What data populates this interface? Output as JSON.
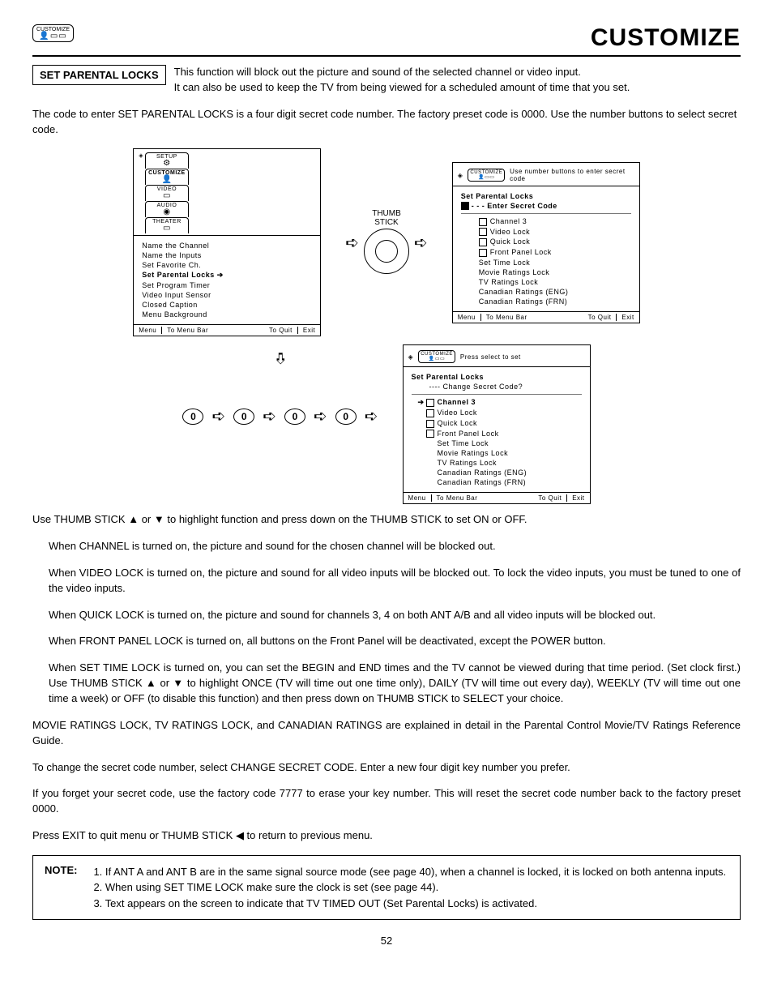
{
  "header": {
    "badge_label": "CUSTOMIZE",
    "page_title": "CUSTOMIZE"
  },
  "section": {
    "label": "SET PARENTAL LOCKS",
    "intro1": "This function will block out the picture and sound of the selected channel or video input.",
    "intro2": "It can also be used to keep the TV from being viewed for a scheduled amount of time that you set."
  },
  "body": {
    "p1": "The code to enter SET PARENTAL LOCKS is a four digit secret code number.  The factory preset code is 0000. Use the number buttons to select secret code.",
    "thumb_label1": "THUMB",
    "thumb_label2": "STICK",
    "p2_a": "Use THUMB STICK ",
    "p2_b": " or ",
    "p2_c": " to highlight function and press down on the THUMB STICK to set ON or OFF.",
    "p3": "When CHANNEL is turned on, the picture and sound for the chosen channel will be blocked out.",
    "p4": "When VIDEO LOCK is turned on, the picture and sound for all video inputs will be blocked out. To lock the video inputs, you must be tuned to one of the video inputs.",
    "p5": "When QUICK LOCK is turned on, the picture and sound for channels 3, 4 on both ANT A/B and all video inputs will be blocked out.",
    "p6": "When FRONT PANEL LOCK is turned on, all buttons on the Front Panel will be deactivated, except the POWER button.",
    "p7_a": "When SET TIME LOCK is turned on, you can set the BEGIN and END times and the TV cannot be viewed during that time period. (Set clock first.) Use THUMB STICK ",
    "p7_b": " or ",
    "p7_c": " to highlight ONCE (TV will time out one time only), DAILY (TV will time out every day), WEEKLY (TV will time out one time a week) or OFF (to disable this function) and then press down on THUMB STICK to SELECT your choice.",
    "p8": "MOVIE RATINGS LOCK, TV RATINGS LOCK, and CANADIAN RATINGS are explained in detail in the Parental Control Movie/TV Ratings Reference Guide.",
    "p9": "To change the secret code number, select CHANGE SECRET CODE.  Enter a new four digit key number you prefer.",
    "p10": "If you forget your secret code, use the factory code 7777 to erase your key number. This will reset the secret code number back to the factory preset 0000.",
    "p11_a": "Press EXIT to quit menu or THUMB STICK ",
    "p11_b": " to return to previous menu."
  },
  "osd1": {
    "tabs": [
      "SETUP",
      "CUSTOMIZE",
      "VIDEO",
      "AUDIO",
      "THEATER"
    ],
    "items": [
      "Name the Channel",
      "Name the Inputs",
      "Set Favorite Ch.",
      "Set Parental Locks",
      "Set Program Timer",
      "Video Input Sensor",
      "Closed Caption",
      "Menu Background"
    ],
    "selected_index": 3,
    "footer": {
      "l": "Menu",
      "c": "To Menu Bar",
      "r1": "To Quit",
      "r2": "Exit"
    }
  },
  "osd2": {
    "hint": "Use number buttons to enter secret code",
    "title": "Set Parental Locks",
    "subtitle": "- - -  Enter Secret Code",
    "items": [
      "Channel 3",
      "Video Lock",
      "Quick Lock",
      "Front Panel Lock",
      "Set Time Lock",
      "Movie Ratings Lock",
      "TV Ratings Lock",
      "Canadian Ratings (ENG)",
      "Canadian Ratings (FRN)"
    ],
    "check_count": 4,
    "footer": {
      "l": "Menu",
      "c": "To Menu Bar",
      "r1": "To Quit",
      "r2": "Exit"
    }
  },
  "osd3": {
    "hint": "Press select to set",
    "title": "Set Parental Locks",
    "subtitle": "----  Change Secret Code?",
    "items": [
      "Channel 3",
      "Video Lock",
      "Quick Lock",
      "Front Panel Lock",
      "Set Time Lock",
      "Movie Ratings Lock",
      "TV Ratings Lock",
      "Canadian Ratings (ENG)",
      "Canadian Ratings (FRN)"
    ],
    "check_count": 4,
    "selected_index": 0,
    "footer": {
      "l": "Menu",
      "c": "To Menu Bar",
      "r1": "To Quit",
      "r2": "Exit"
    }
  },
  "code_digits": [
    "0",
    "0",
    "0",
    "0"
  ],
  "note": {
    "label": "NOTE:",
    "n1": "1. If ANT A and ANT B are in the same signal source mode (see page 40), when a channel is locked, it is locked on both antenna inputs.",
    "n2": "2. When using SET TIME LOCK make sure the clock is set (see page 44).",
    "n3": "3. Text appears on the screen to indicate that TV TIMED OUT (Set Parental Locks) is activated."
  },
  "glyphs": {
    "up": "▲",
    "down": "▼",
    "left": "◀",
    "right_ptr": "➔"
  },
  "page_number": "52"
}
